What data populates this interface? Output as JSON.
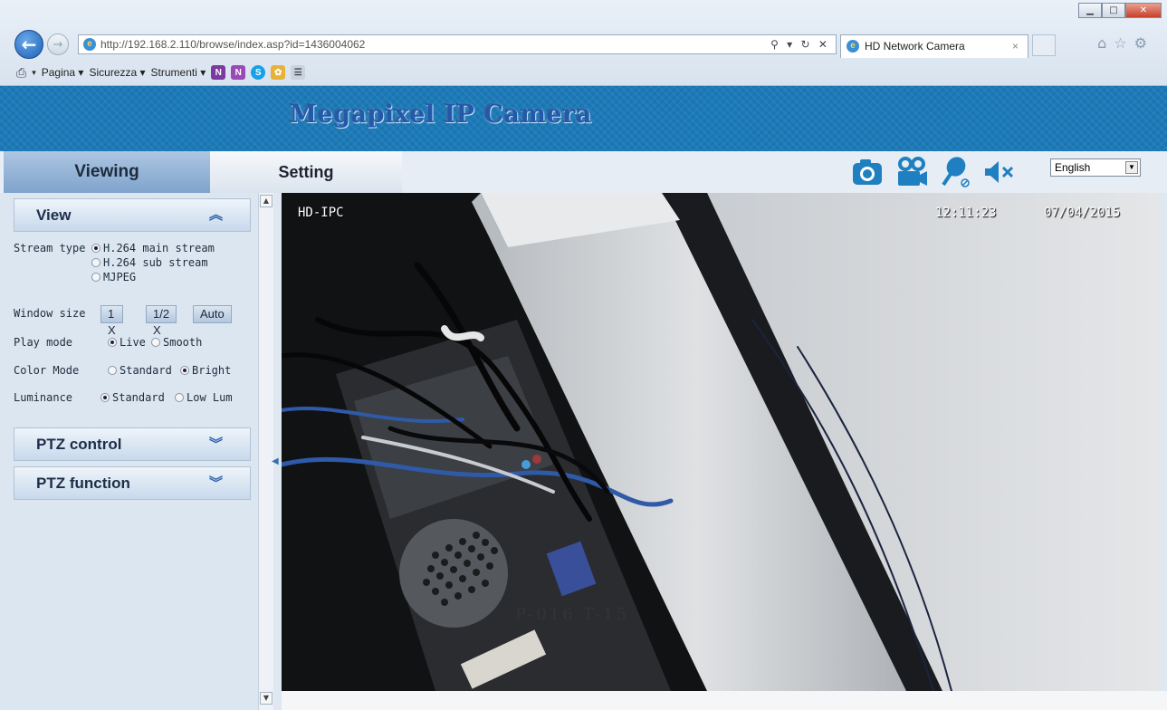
{
  "browser": {
    "url": "http://192.168.2.110/browse/index.asp?id=1436004062",
    "address_tools": "⚲ ▾ ↻ ✕",
    "tab_title": "HD Network Camera",
    "tab_close": "×",
    "command_bar": [
      "Pagina ▾",
      "Sicurezza ▾",
      "Strumenti ▾"
    ]
  },
  "header": {
    "title": "Megapixel IP Camera"
  },
  "tabs": {
    "viewing": "Viewing",
    "setting": "Setting"
  },
  "language": {
    "selected": "English"
  },
  "view_panel": {
    "title": "View",
    "stream_type_label": "Stream type",
    "stream_options": [
      "H.264 main stream",
      "H.264 sub stream",
      "MJPEG"
    ],
    "stream_selected": "H.264 main stream",
    "window_size_label": "Window size",
    "window_sizes": [
      "1 X",
      "1/2 X",
      "Auto"
    ],
    "play_mode_label": "Play mode",
    "play_mode_options": [
      "Live",
      "Smooth"
    ],
    "play_mode_selected": "Live",
    "color_mode_label": "Color Mode",
    "color_mode_options": [
      "Standard",
      "Bright"
    ],
    "color_mode_selected": "Bright",
    "luminance_label": "Luminance",
    "luminance_options": [
      "Standard",
      "Low Lum"
    ],
    "luminance_selected": "Standard"
  },
  "ptz_control": {
    "title": "PTZ control"
  },
  "ptz_function": {
    "title": "PTZ function"
  },
  "video": {
    "camera_name": "HD-IPC",
    "time": "12:11:23",
    "date": "07/04/2015",
    "label_text": "P-016 T-15"
  },
  "icons": {
    "snapshot": "camera-icon",
    "record": "video-record-icon",
    "microphone": "microphone-icon",
    "mute": "speaker-mute-icon",
    "accent": "#1f7fc1"
  }
}
